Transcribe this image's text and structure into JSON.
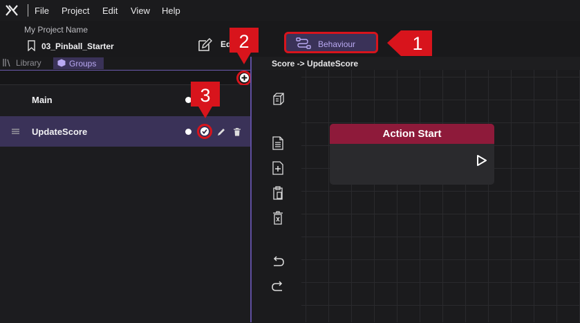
{
  "menubar": {
    "logo_icon": "app-logo-icon",
    "items": [
      "File",
      "Project",
      "Edit",
      "View",
      "Help"
    ]
  },
  "header": {
    "project_name": "My Project Name",
    "scene_name": "03_Pinball_Starter",
    "edit_label": "Ed",
    "behaviour_label": "Behaviour"
  },
  "tabs": {
    "library": "Library",
    "groups": "Groups"
  },
  "groups": [
    {
      "label": "Main"
    },
    {
      "label": "UpdateScore"
    }
  ],
  "canvas": {
    "breadcrumb": "Score -> UpdateScore",
    "node_title": "Action Start"
  },
  "callouts": [
    "1",
    "2",
    "3"
  ],
  "colors": {
    "accent": "#b9a9f2",
    "selected_bg": "#3a3258",
    "node_header": "#8e1a3a",
    "callout_red": "#d8141c"
  }
}
